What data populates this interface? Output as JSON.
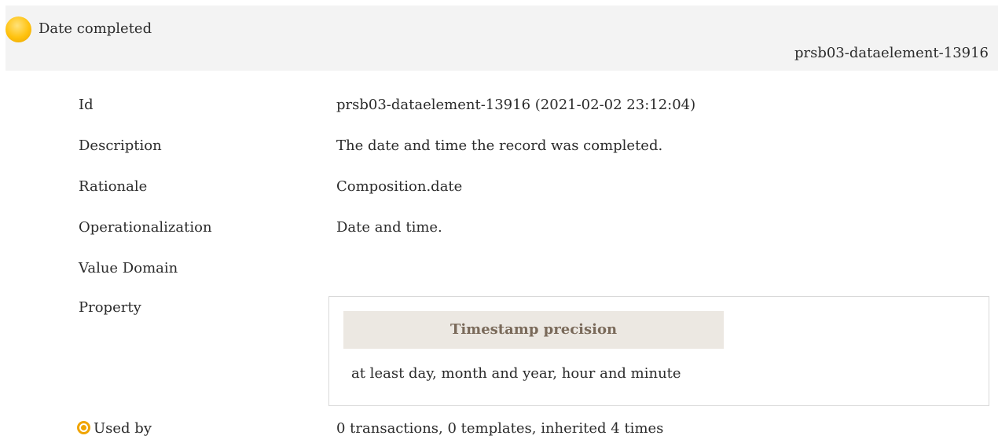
{
  "header": {
    "status_icon": "status-dot-icon",
    "title": "Date completed",
    "id_right": "prsb03-dataelement-13916"
  },
  "rows": {
    "id": {
      "label": "Id",
      "value": "prsb03-dataelement-13916 (2021-02-02 23:12:04)"
    },
    "description": {
      "label": "Description",
      "value": "The date and time the record was completed."
    },
    "rationale": {
      "label": "Rationale",
      "value": "Composition.date"
    },
    "operationalization": {
      "label": "Operationalization",
      "value": "Date and time."
    },
    "value_domain": {
      "label": "Value Domain",
      "value": ""
    },
    "property": {
      "label": "Property",
      "heading": "Timestamp precision",
      "value": "at least day, month and year, hour and minute"
    },
    "used_by": {
      "icon": "target-icon",
      "label": "Used by",
      "value": "0 transactions, 0 templates, inherited 4 times"
    }
  },
  "colors": {
    "header_bg": "#f3f3f3",
    "status_dot": "#ffc20e",
    "property_heading_bg": "#ece8e2",
    "property_heading_text": "#7a6a5a"
  }
}
